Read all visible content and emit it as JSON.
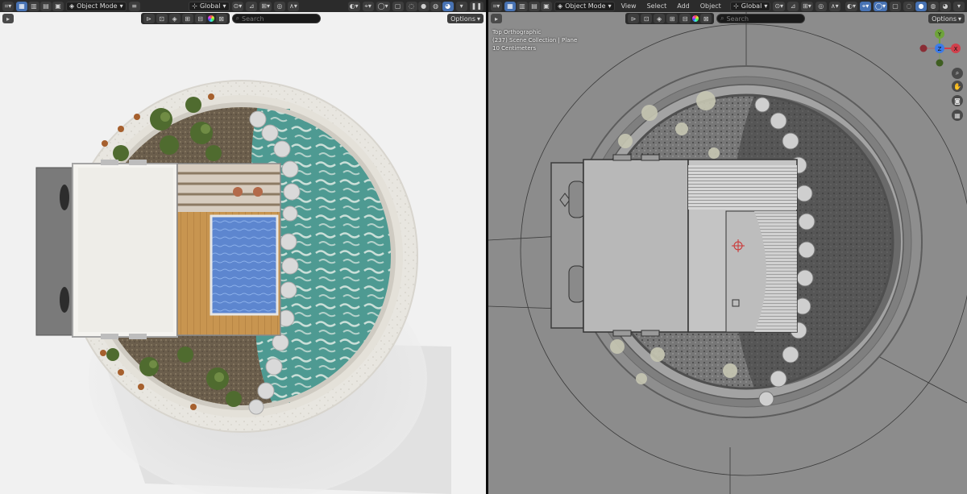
{
  "left_viewport": {
    "mode_label": "Object Mode",
    "orientation_label": "Global",
    "search_placeholder": "Search",
    "options_label": "Options"
  },
  "right_viewport": {
    "mode_label": "Object Mode",
    "menu": [
      "View",
      "Select",
      "Add",
      "Object"
    ],
    "orientation_label": "Global",
    "search_placeholder": "Search",
    "options_label": "Options",
    "overlay_view": "Top Orthographic",
    "overlay_collection": "(237) Scene Collection | Plane",
    "overlay_scale": "10 Centimeters",
    "gizmo_axes": [
      "Y",
      "X",
      "Z"
    ]
  },
  "colors": {
    "header_bg": "#2b2b2b",
    "accent_blue": "#4772b3",
    "axis_x": "#d0404c",
    "axis_y": "#6ea33a",
    "axis_z": "#3d7be8",
    "solid_bg": "#8c8c8c",
    "render_bg": "#f1f1f1",
    "water": "#5aa39b",
    "pool": "#4f7fc2",
    "wood": "#c99a55"
  },
  "icons": [
    "editor-type-icon",
    "select-box-icon",
    "hamburger-icon",
    "orientation-icon",
    "pivot-icon",
    "snap-icon",
    "proportional-icon",
    "visibility-icon",
    "overlay-icon",
    "xray-icon",
    "shading-wire-icon",
    "shading-solid-icon",
    "shading-material-icon",
    "shading-rendered-icon",
    "pause-icon",
    "zoom-icon",
    "hand-icon",
    "camera-icon",
    "grid-icon",
    "search-icon"
  ]
}
